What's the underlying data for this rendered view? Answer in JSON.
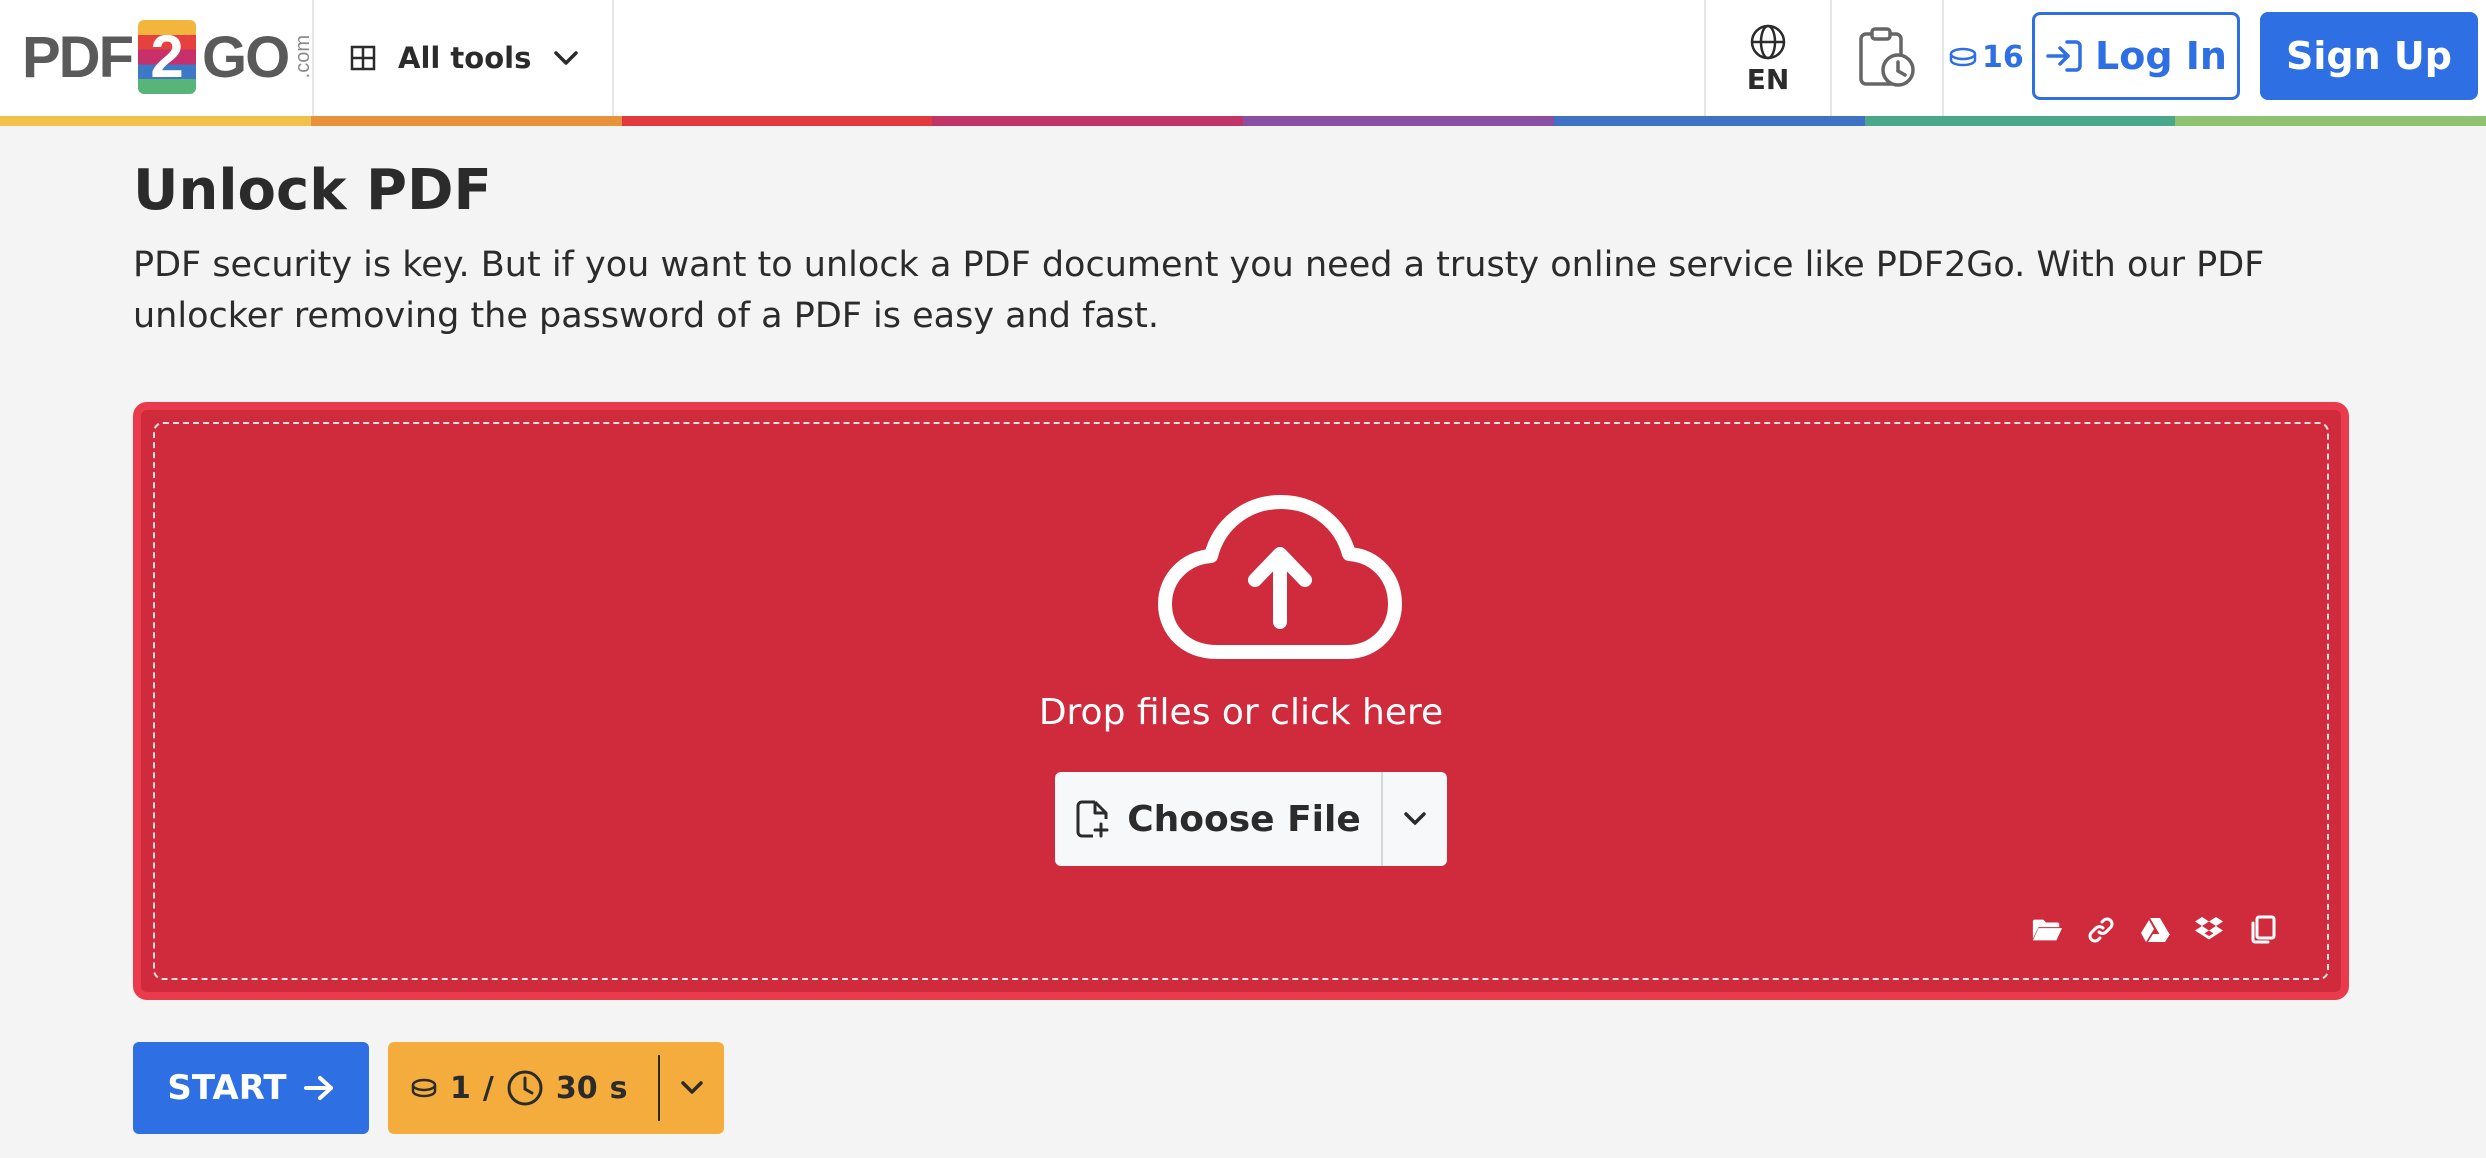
{
  "header": {
    "logo": {
      "left": "PDF",
      "middle": "2",
      "right": "GO",
      "suffix": ".com"
    },
    "all_tools_label": "All tools",
    "language_code": "EN",
    "credits_count": "16",
    "login_label": "Log In",
    "signup_label": "Sign Up",
    "rainbow_colors": [
      "#f0c14b",
      "#e8923b",
      "#e0393e",
      "#c23466",
      "#8a4fa3",
      "#3f72c5",
      "#4aa78a",
      "#8cc270"
    ]
  },
  "main": {
    "title": "Unlock PDF",
    "description": "PDF security is key. But if you want to unlock a PDF document you need a trusty online service like PDF2Go. With our PDF unlocker removing the password of a PDF is easy and fast."
  },
  "dropzone": {
    "drop_text": "Drop files or click here",
    "choose_file_label": "Choose File",
    "sources": [
      "folder-icon",
      "link-icon",
      "google-drive-icon",
      "dropbox-icon",
      "clipboard-icon"
    ]
  },
  "actions": {
    "start_label": "START",
    "cost_credits": "1",
    "cost_divider": "/",
    "cost_time": "30",
    "cost_time_unit": "s"
  },
  "colors": {
    "primary_blue": "#2f6fe4",
    "dropzone_red": "#cf2b3c",
    "cost_orange": "#f4ac3c"
  }
}
